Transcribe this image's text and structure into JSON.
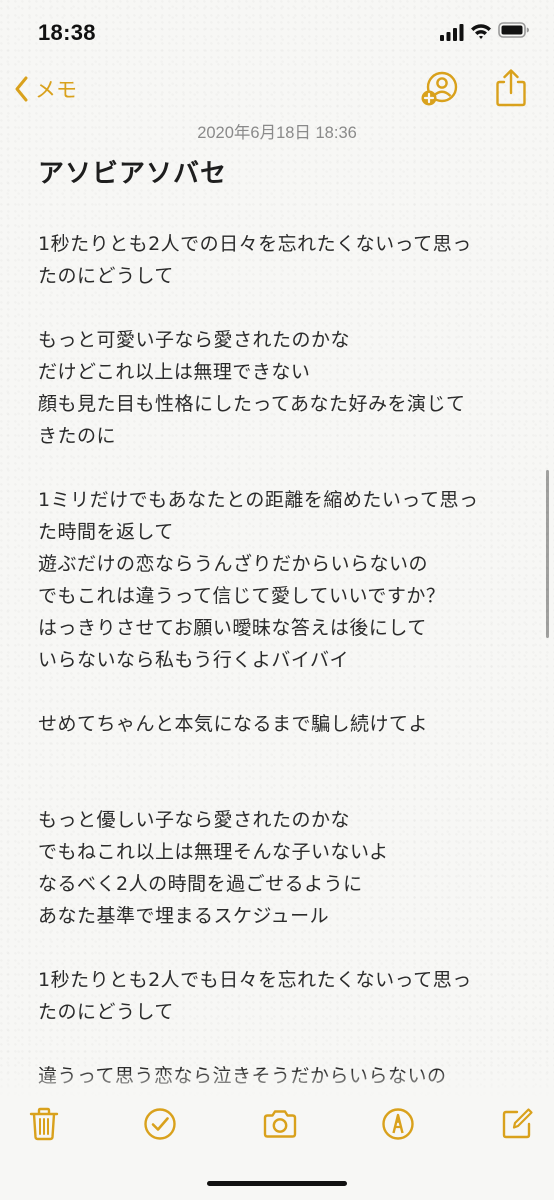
{
  "status_bar": {
    "time": "18:38",
    "icons": [
      "cellular-signal-icon",
      "wifi-icon",
      "battery-icon"
    ]
  },
  "nav": {
    "back_label": "メモ",
    "icons": [
      "chevron-left-icon",
      "add-person-icon",
      "share-icon"
    ]
  },
  "note": {
    "date": "2020年6月18日 18:36",
    "title": "アソビアソバセ",
    "lines": [
      "1秒たりとも2人での日々を忘れたくないって思っ",
      "たのにどうして",
      "",
      "もっと可愛い子なら愛されたのかな",
      "だけどこれ以上は無理できない",
      "顔も見た目も性格にしたってあなた好みを演じて",
      "きたのに",
      "",
      "1ミリだけでもあなたとの距離を縮めたいって思っ",
      "た時間を返して",
      "遊ぶだけの恋ならうんざりだからいらないの",
      "でもこれは違うって信じて愛していいですか？",
      "はっきりさせてお願い曖昧な答えは後にして",
      "いらないなら私もう行くよバイバイ",
      "",
      "せめてちゃんと本気になるまで騙し続けてよ",
      "",
      "",
      "もっと優しい子なら愛されたのかな",
      "でもねこれ以上は無理そんな子いないよ",
      "なるべく2人の時間を過ごせるように",
      "あなた基準で埋まるスケジュール",
      "",
      "1秒たりとも2人でも日々を忘れたくないって思っ",
      "たのにどうして",
      "",
      "違うって思う恋なら泣きそうだからいらないの"
    ]
  },
  "toolbar": {
    "icons": [
      "trash-icon",
      "checklist-icon",
      "camera-icon",
      "markup-pen-icon",
      "compose-icon"
    ]
  },
  "colors": {
    "accent": "#d9a11c",
    "background": "#f7f7f5",
    "text": "#2b2b2b",
    "date": "#8a8a8a"
  }
}
